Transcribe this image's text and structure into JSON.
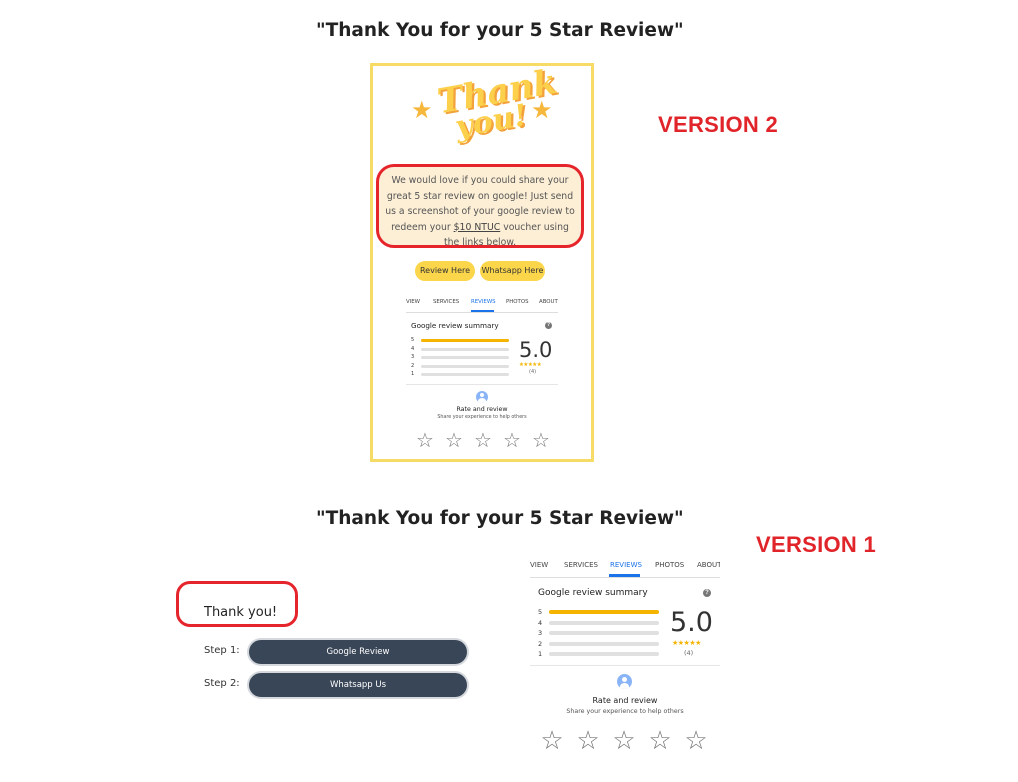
{
  "section_v2": {
    "title": "\"Thank You for your 5 Star Review\"",
    "version_label": "VERSION 2"
  },
  "section_v1": {
    "title": "\"Thank You for your 5 Star Review\"",
    "version_label": "VERSION 1"
  },
  "card2": {
    "headline_line1": "Thank",
    "headline_line2": "you!",
    "message_pre": "We would love if you could share your great 5 star review on google! Just send us a screenshot of your google review to redeem your ",
    "message_voucher": "$10 NTUC",
    "message_post": " voucher using the links below.",
    "review_button": "Review Here",
    "whatsapp_button": "Whatsapp Here"
  },
  "review_widget": {
    "tabs": [
      "VIEW",
      "SERVICES",
      "REVIEWS",
      "PHOTOS",
      "ABOUT"
    ],
    "active_tab": "REVIEWS",
    "summary_title": "Google review summary",
    "help_icon": "?",
    "rows": [
      {
        "star": "5",
        "fraction": 1.0
      },
      {
        "star": "4",
        "fraction": 0.0
      },
      {
        "star": "3",
        "fraction": 0.0
      },
      {
        "star": "2",
        "fraction": 0.0
      },
      {
        "star": "1",
        "fraction": 0.0
      }
    ],
    "rating": "5.0",
    "rating_stars": "★★★★★",
    "rating_count": "(4)",
    "rate_title": "Rate and review",
    "rate_subtitle": "Share your experience to help others",
    "empty_star": "☆",
    "accent_color": "#1a73e8",
    "star_color": "#f4b400"
  },
  "version1": {
    "thank_text": "Thank you!",
    "step1_label": "Step 1:",
    "step1_button": "Google Review",
    "step2_label": "Step 2:",
    "step2_button": "Whatsapp Us"
  }
}
